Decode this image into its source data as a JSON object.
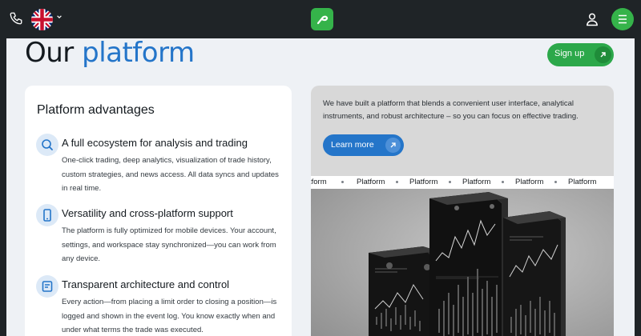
{
  "header": {
    "phone_icon": "phone-icon",
    "language_flag": "uk-flag-icon",
    "language_chevron": "chevron-down-icon",
    "logo_icon": "brand-logo-icon",
    "user_icon": "user-icon",
    "menu_icon": "menu-icon"
  },
  "title": {
    "prefix": "Our",
    "accent": "platform"
  },
  "signup": {
    "label": "Sign up",
    "icon": "arrow-up-right-icon"
  },
  "advantages": {
    "title": "Platform advantages",
    "items": [
      {
        "icon": "ecosystem-icon",
        "title": "A full ecosystem for analysis and trading",
        "text": "One-click trading, deep analytics, visualization of trade history, custom strategies, and news access. All data syncs and updates in real time."
      },
      {
        "icon": "mobile-icon",
        "title": "Versatility and cross-platform support",
        "text": "The platform is fully optimized for mobile devices. Your account, settings, and workspace stay synchronized—you can work from any device."
      },
      {
        "icon": "log-icon",
        "title": "Transparent architecture and control",
        "text": "Every action—from placing a limit order to closing a position—is logged and shown in the event log. You know exactly when and under what terms the trade was executed."
      }
    ]
  },
  "intro": {
    "text": "We have built a platform that blends a convenient user interface, analytical instruments, and robust architecture – so you can focus on effective trading.",
    "learn_more": "Learn more",
    "learn_icon": "arrow-up-right-icon"
  },
  "ticker": [
    "tform",
    "Platform",
    "Platform",
    "Platform",
    "Platform",
    "Platform",
    "Platform"
  ],
  "colors": {
    "accent_green": "#35b34a",
    "accent_blue": "#2475c9",
    "header_bg": "#1f2427"
  }
}
